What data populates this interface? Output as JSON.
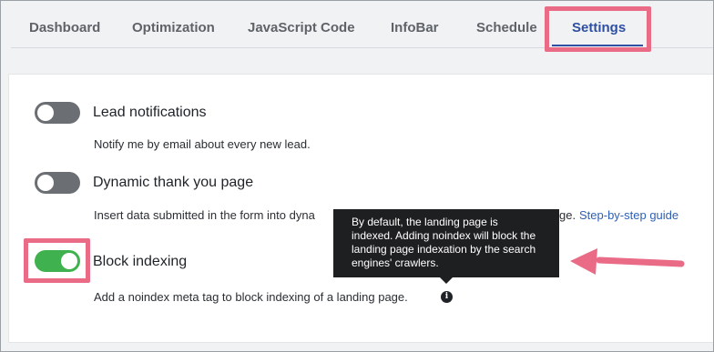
{
  "tabs": [
    {
      "label": "Dashboard"
    },
    {
      "label": "Optimization"
    },
    {
      "label": "JavaScript Code"
    },
    {
      "label": "InfoBar"
    },
    {
      "label": "Schedule"
    },
    {
      "label": "Settings"
    }
  ],
  "active_tab": "Settings",
  "settings": [
    {
      "title": "Lead notifications",
      "description": "Notify me by email about every new lead.",
      "enabled": false
    },
    {
      "title": "Dynamic thank you page",
      "description": "Insert data submitted in the form into dyna",
      "description_tail": "ge.",
      "link": "Step-by-step guide",
      "enabled": false
    },
    {
      "title": "Block indexing",
      "description": "Add a noindex meta tag to block indexing of a landing page.",
      "enabled": true
    }
  ],
  "tooltip": {
    "text": "By default, the landing page is\nindexed. Adding noindex will block the\nlanding page indexation by the search\nengines' crawlers."
  },
  "icons": {
    "info": "info-icon"
  },
  "colors": {
    "accent": "#2f4fa2",
    "toggle_on": "#3fb24f",
    "toggle_off": "#6b6e72",
    "highlight": "#e96b86",
    "link": "#2f5fb3"
  }
}
